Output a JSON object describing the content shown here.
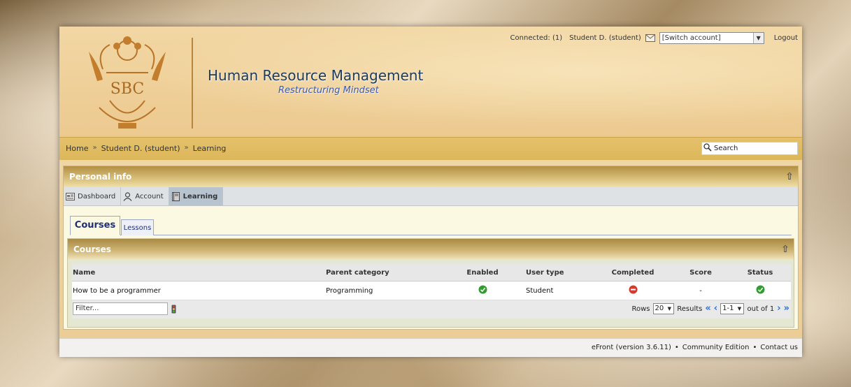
{
  "header": {
    "logo_text": "SBC",
    "title": "Human Resource Management",
    "subtitle": "Restructuring Mindset",
    "connected_label": "Connected: (1)",
    "user_label": "Student D. (student)",
    "switch_account_value": "[Switch account]",
    "logout_label": "Logout"
  },
  "breadcrumb": {
    "items": [
      "Home",
      "Student D. (student)",
      "Learning"
    ],
    "separator": "»"
  },
  "search": {
    "value": "Search"
  },
  "personal_panel": {
    "title": "Personal info",
    "nav_tabs": [
      {
        "label": "Dashboard",
        "icon": "dashboard-icon"
      },
      {
        "label": "Account",
        "icon": "user-icon"
      },
      {
        "label": "Learning",
        "icon": "book-icon",
        "active": true
      }
    ]
  },
  "subtabs": {
    "courses": "Courses",
    "lessons": "Lessons"
  },
  "courses": {
    "title": "Courses",
    "columns": [
      "Name",
      "Parent category",
      "Enabled",
      "User type",
      "Completed",
      "Score",
      "Status"
    ],
    "rows": [
      {
        "name": "How to be a programmer",
        "parent_category": "Programming",
        "enabled": "check-icon",
        "user_type": "Student",
        "completed": "not-completed-icon",
        "score": "-",
        "status": "check-icon"
      }
    ],
    "filter_placeholder": "Filter...",
    "rows_label": "Rows",
    "rows_value": "20",
    "results_label": "Results",
    "results_value": "1-1",
    "out_of": "out of 1"
  },
  "footer": {
    "version": "eFront (version 3.6.11)",
    "edition": "Community Edition",
    "contact": "Contact us",
    "dot": "•"
  },
  "colors": {
    "accent_blue": "#2a6fd6",
    "title_blue": "#1d3b5c",
    "header_gold": "#dcb659",
    "ok_green": "#2f9e2f",
    "stop_red": "#d63a2a"
  }
}
